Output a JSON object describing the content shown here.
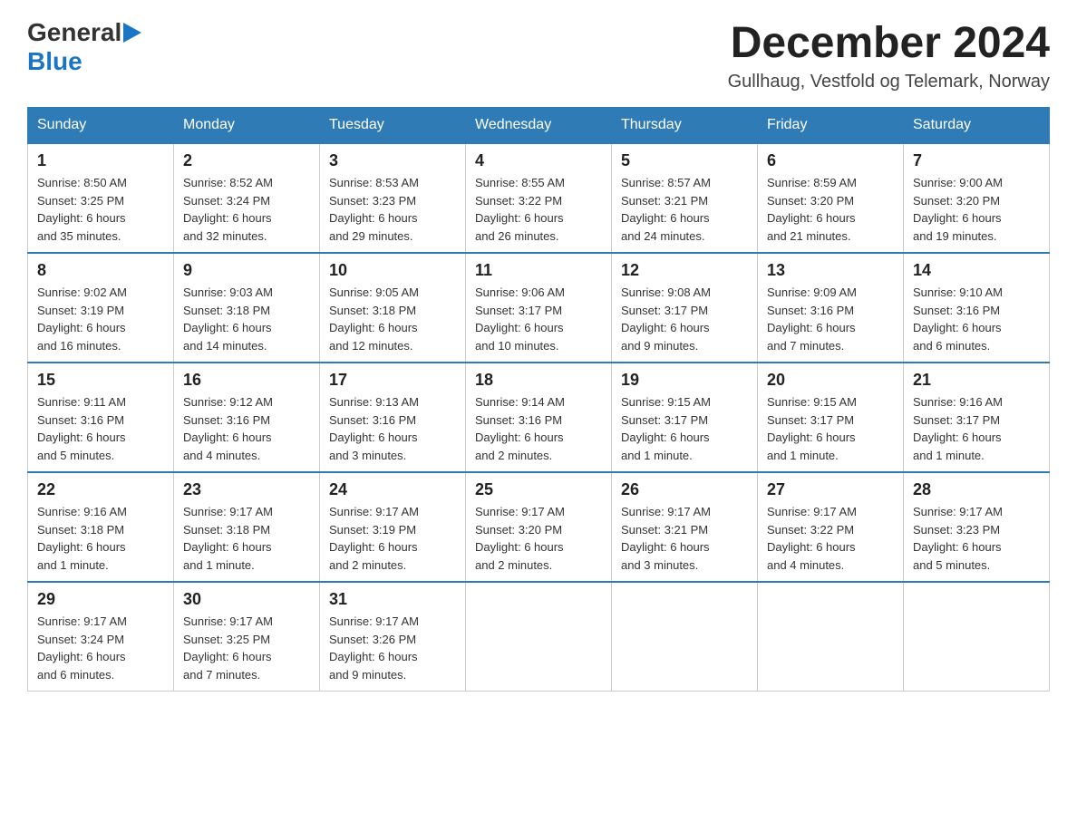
{
  "header": {
    "logo_general": "General",
    "logo_blue": "Blue",
    "month_title": "December 2024",
    "location": "Gullhaug, Vestfold og Telemark, Norway"
  },
  "days_of_week": [
    "Sunday",
    "Monday",
    "Tuesday",
    "Wednesday",
    "Thursday",
    "Friday",
    "Saturday"
  ],
  "weeks": [
    [
      {
        "day": "1",
        "sunrise": "8:50 AM",
        "sunset": "3:25 PM",
        "daylight": "6 hours and 35 minutes."
      },
      {
        "day": "2",
        "sunrise": "8:52 AM",
        "sunset": "3:24 PM",
        "daylight": "6 hours and 32 minutes."
      },
      {
        "day": "3",
        "sunrise": "8:53 AM",
        "sunset": "3:23 PM",
        "daylight": "6 hours and 29 minutes."
      },
      {
        "day": "4",
        "sunrise": "8:55 AM",
        "sunset": "3:22 PM",
        "daylight": "6 hours and 26 minutes."
      },
      {
        "day": "5",
        "sunrise": "8:57 AM",
        "sunset": "3:21 PM",
        "daylight": "6 hours and 24 minutes."
      },
      {
        "day": "6",
        "sunrise": "8:59 AM",
        "sunset": "3:20 PM",
        "daylight": "6 hours and 21 minutes."
      },
      {
        "day": "7",
        "sunrise": "9:00 AM",
        "sunset": "3:20 PM",
        "daylight": "6 hours and 19 minutes."
      }
    ],
    [
      {
        "day": "8",
        "sunrise": "9:02 AM",
        "sunset": "3:19 PM",
        "daylight": "6 hours and 16 minutes."
      },
      {
        "day": "9",
        "sunrise": "9:03 AM",
        "sunset": "3:18 PM",
        "daylight": "6 hours and 14 minutes."
      },
      {
        "day": "10",
        "sunrise": "9:05 AM",
        "sunset": "3:18 PM",
        "daylight": "6 hours and 12 minutes."
      },
      {
        "day": "11",
        "sunrise": "9:06 AM",
        "sunset": "3:17 PM",
        "daylight": "6 hours and 10 minutes."
      },
      {
        "day": "12",
        "sunrise": "9:08 AM",
        "sunset": "3:17 PM",
        "daylight": "6 hours and 9 minutes."
      },
      {
        "day": "13",
        "sunrise": "9:09 AM",
        "sunset": "3:16 PM",
        "daylight": "6 hours and 7 minutes."
      },
      {
        "day": "14",
        "sunrise": "9:10 AM",
        "sunset": "3:16 PM",
        "daylight": "6 hours and 6 minutes."
      }
    ],
    [
      {
        "day": "15",
        "sunrise": "9:11 AM",
        "sunset": "3:16 PM",
        "daylight": "6 hours and 5 minutes."
      },
      {
        "day": "16",
        "sunrise": "9:12 AM",
        "sunset": "3:16 PM",
        "daylight": "6 hours and 4 minutes."
      },
      {
        "day": "17",
        "sunrise": "9:13 AM",
        "sunset": "3:16 PM",
        "daylight": "6 hours and 3 minutes."
      },
      {
        "day": "18",
        "sunrise": "9:14 AM",
        "sunset": "3:16 PM",
        "daylight": "6 hours and 2 minutes."
      },
      {
        "day": "19",
        "sunrise": "9:15 AM",
        "sunset": "3:17 PM",
        "daylight": "6 hours and 1 minute."
      },
      {
        "day": "20",
        "sunrise": "9:15 AM",
        "sunset": "3:17 PM",
        "daylight": "6 hours and 1 minute."
      },
      {
        "day": "21",
        "sunrise": "9:16 AM",
        "sunset": "3:17 PM",
        "daylight": "6 hours and 1 minute."
      }
    ],
    [
      {
        "day": "22",
        "sunrise": "9:16 AM",
        "sunset": "3:18 PM",
        "daylight": "6 hours and 1 minute."
      },
      {
        "day": "23",
        "sunrise": "9:17 AM",
        "sunset": "3:18 PM",
        "daylight": "6 hours and 1 minute."
      },
      {
        "day": "24",
        "sunrise": "9:17 AM",
        "sunset": "3:19 PM",
        "daylight": "6 hours and 2 minutes."
      },
      {
        "day": "25",
        "sunrise": "9:17 AM",
        "sunset": "3:20 PM",
        "daylight": "6 hours and 2 minutes."
      },
      {
        "day": "26",
        "sunrise": "9:17 AM",
        "sunset": "3:21 PM",
        "daylight": "6 hours and 3 minutes."
      },
      {
        "day": "27",
        "sunrise": "9:17 AM",
        "sunset": "3:22 PM",
        "daylight": "6 hours and 4 minutes."
      },
      {
        "day": "28",
        "sunrise": "9:17 AM",
        "sunset": "3:23 PM",
        "daylight": "6 hours and 5 minutes."
      }
    ],
    [
      {
        "day": "29",
        "sunrise": "9:17 AM",
        "sunset": "3:24 PM",
        "daylight": "6 hours and 6 minutes."
      },
      {
        "day": "30",
        "sunrise": "9:17 AM",
        "sunset": "3:25 PM",
        "daylight": "6 hours and 7 minutes."
      },
      {
        "day": "31",
        "sunrise": "9:17 AM",
        "sunset": "3:26 PM",
        "daylight": "6 hours and 9 minutes."
      },
      null,
      null,
      null,
      null
    ]
  ],
  "labels": {
    "sunrise": "Sunrise:",
    "sunset": "Sunset:",
    "daylight": "Daylight:"
  }
}
